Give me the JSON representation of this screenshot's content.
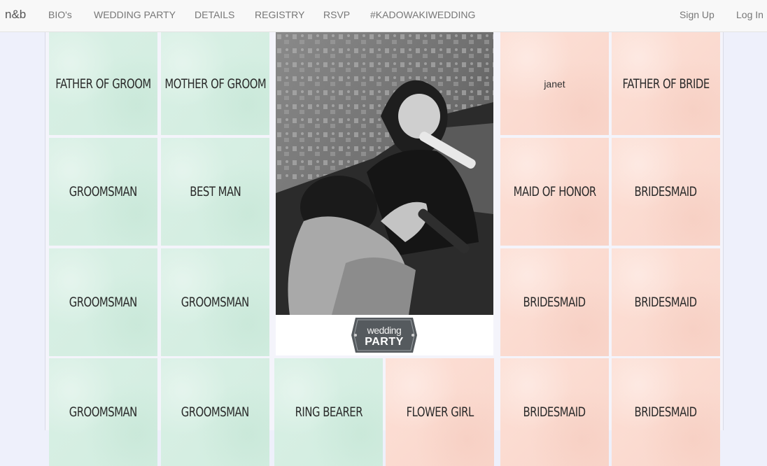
{
  "nav": {
    "brand": "n&b",
    "links": [
      "BIO's",
      "WEDDING PARTY",
      "DETAILS",
      "REGISTRY",
      "RSVP",
      "#KADOWAKIWEDDING"
    ],
    "sign_up": "Sign Up",
    "log_in": "Log In"
  },
  "colors": {
    "groom_side": "#d6efe3",
    "bride_side": "#fbdcd2",
    "navbar": "#f8f8f8"
  },
  "tiles": {
    "r1c1": "FATHER OF GROOM",
    "r1c2": "MOTHER OF GROOM",
    "r1c4": "janet",
    "r1c5": "FATHER OF BRIDE",
    "r2c1": "GROOMSMAN",
    "r2c2": "BEST MAN",
    "r2c4": "MAID OF HONOR",
    "r2c5": "BRIDESMAID",
    "r3c1": "GROOMSMAN",
    "r3c2": "GROOMSMAN",
    "r3c4": "BRIDESMAID",
    "r3c5": "BRIDESMAID",
    "r4c1": "GROOMSMAN",
    "r4c2": "GROOMSMAN",
    "r4c3a": "RING BEARER",
    "r4c3b": "FLOWER GIRL",
    "r4c4": "BRIDESMAID",
    "r4c5": "BRIDESMAID"
  },
  "badge": {
    "line1": "wedding",
    "line2": "PARTY"
  }
}
